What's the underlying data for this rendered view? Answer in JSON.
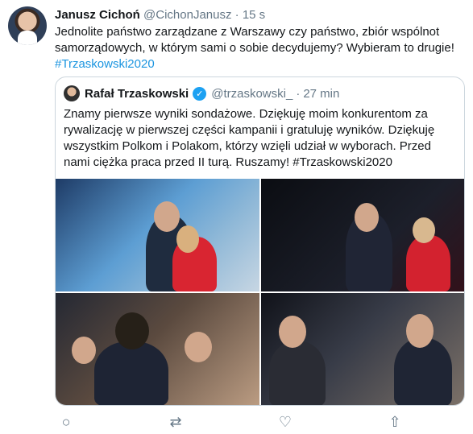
{
  "tweet": {
    "author": {
      "name": "Janusz Cichoń",
      "handle": "@CichonJanusz",
      "separator": "·",
      "time": "15 s"
    },
    "text_line1": "Jednolite państwo zarządzane z Warszawy czy państwo, zbiór wspólnot",
    "text_line2": "samorządowych, w którym sami o sobie decydujemy? Wybieram to drugie!",
    "hashtag": "#Trzaskowski2020"
  },
  "quote": {
    "author": {
      "name": "Rafał Trzaskowski",
      "verified_icon": "✓",
      "handle": "@trzaskowski_",
      "separator": "·",
      "time": "27 min"
    },
    "text": "Znamy pierwsze wyniki sondażowe. Dziękuję moim konkurentom za rywalizację w pierwszej części kampanii i gratuluję wyników. Dziękuję wszystkim Polkom i Polakom, którzy wzięli udział w wyborach. Przed nami ciężka praca przed II turą. Ruszamy! #Trzaskowski2020"
  },
  "actions": {
    "reply_icon": "○",
    "retweet_icon": "⇄",
    "like_icon": "♡",
    "share_icon": "⇧"
  }
}
